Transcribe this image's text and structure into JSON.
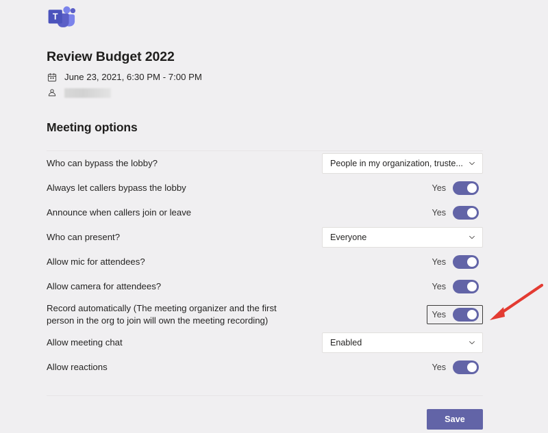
{
  "app": {
    "logo_icon": "microsoft-teams-logo",
    "brand_color": "#6264a7"
  },
  "meeting": {
    "title": "Review Budget 2022",
    "calendar_icon": "calendar-icon",
    "datetime": "June 23, 2021, 6:30 PM - 7:00 PM",
    "organizer_icon": "person-icon",
    "organizer_name": ""
  },
  "section": {
    "heading": "Meeting options"
  },
  "options": [
    {
      "label": "Who can bypass the lobby?",
      "control": "dropdown",
      "value": "People in my organization, truste...",
      "icon": "chevron-down-icon"
    },
    {
      "label": "Always let callers bypass the lobby",
      "control": "toggle",
      "value": "Yes",
      "on": true,
      "focused": false
    },
    {
      "label": "Announce when callers join or leave",
      "control": "toggle",
      "value": "Yes",
      "on": true,
      "focused": false
    },
    {
      "label": "Who can present?",
      "control": "dropdown",
      "value": "Everyone",
      "icon": "chevron-down-icon"
    },
    {
      "label": "Allow mic for attendees?",
      "control": "toggle",
      "value": "Yes",
      "on": true,
      "focused": false
    },
    {
      "label": "Allow camera for attendees?",
      "control": "toggle",
      "value": "Yes",
      "on": true,
      "focused": false
    },
    {
      "label": "Record automatically (The meeting organizer and the first person in the org to join will own the meeting recording)",
      "control": "toggle",
      "value": "Yes",
      "on": true,
      "focused": true
    },
    {
      "label": "Allow meeting chat",
      "control": "dropdown",
      "value": "Enabled",
      "icon": "chevron-down-icon"
    },
    {
      "label": "Allow reactions",
      "control": "toggle",
      "value": "Yes",
      "on": true,
      "focused": false
    }
  ],
  "footer": {
    "save_label": "Save"
  },
  "annotation": {
    "arrow_icon": "red-arrow-pointing-to-record-toggle",
    "color": "#e33b32"
  }
}
